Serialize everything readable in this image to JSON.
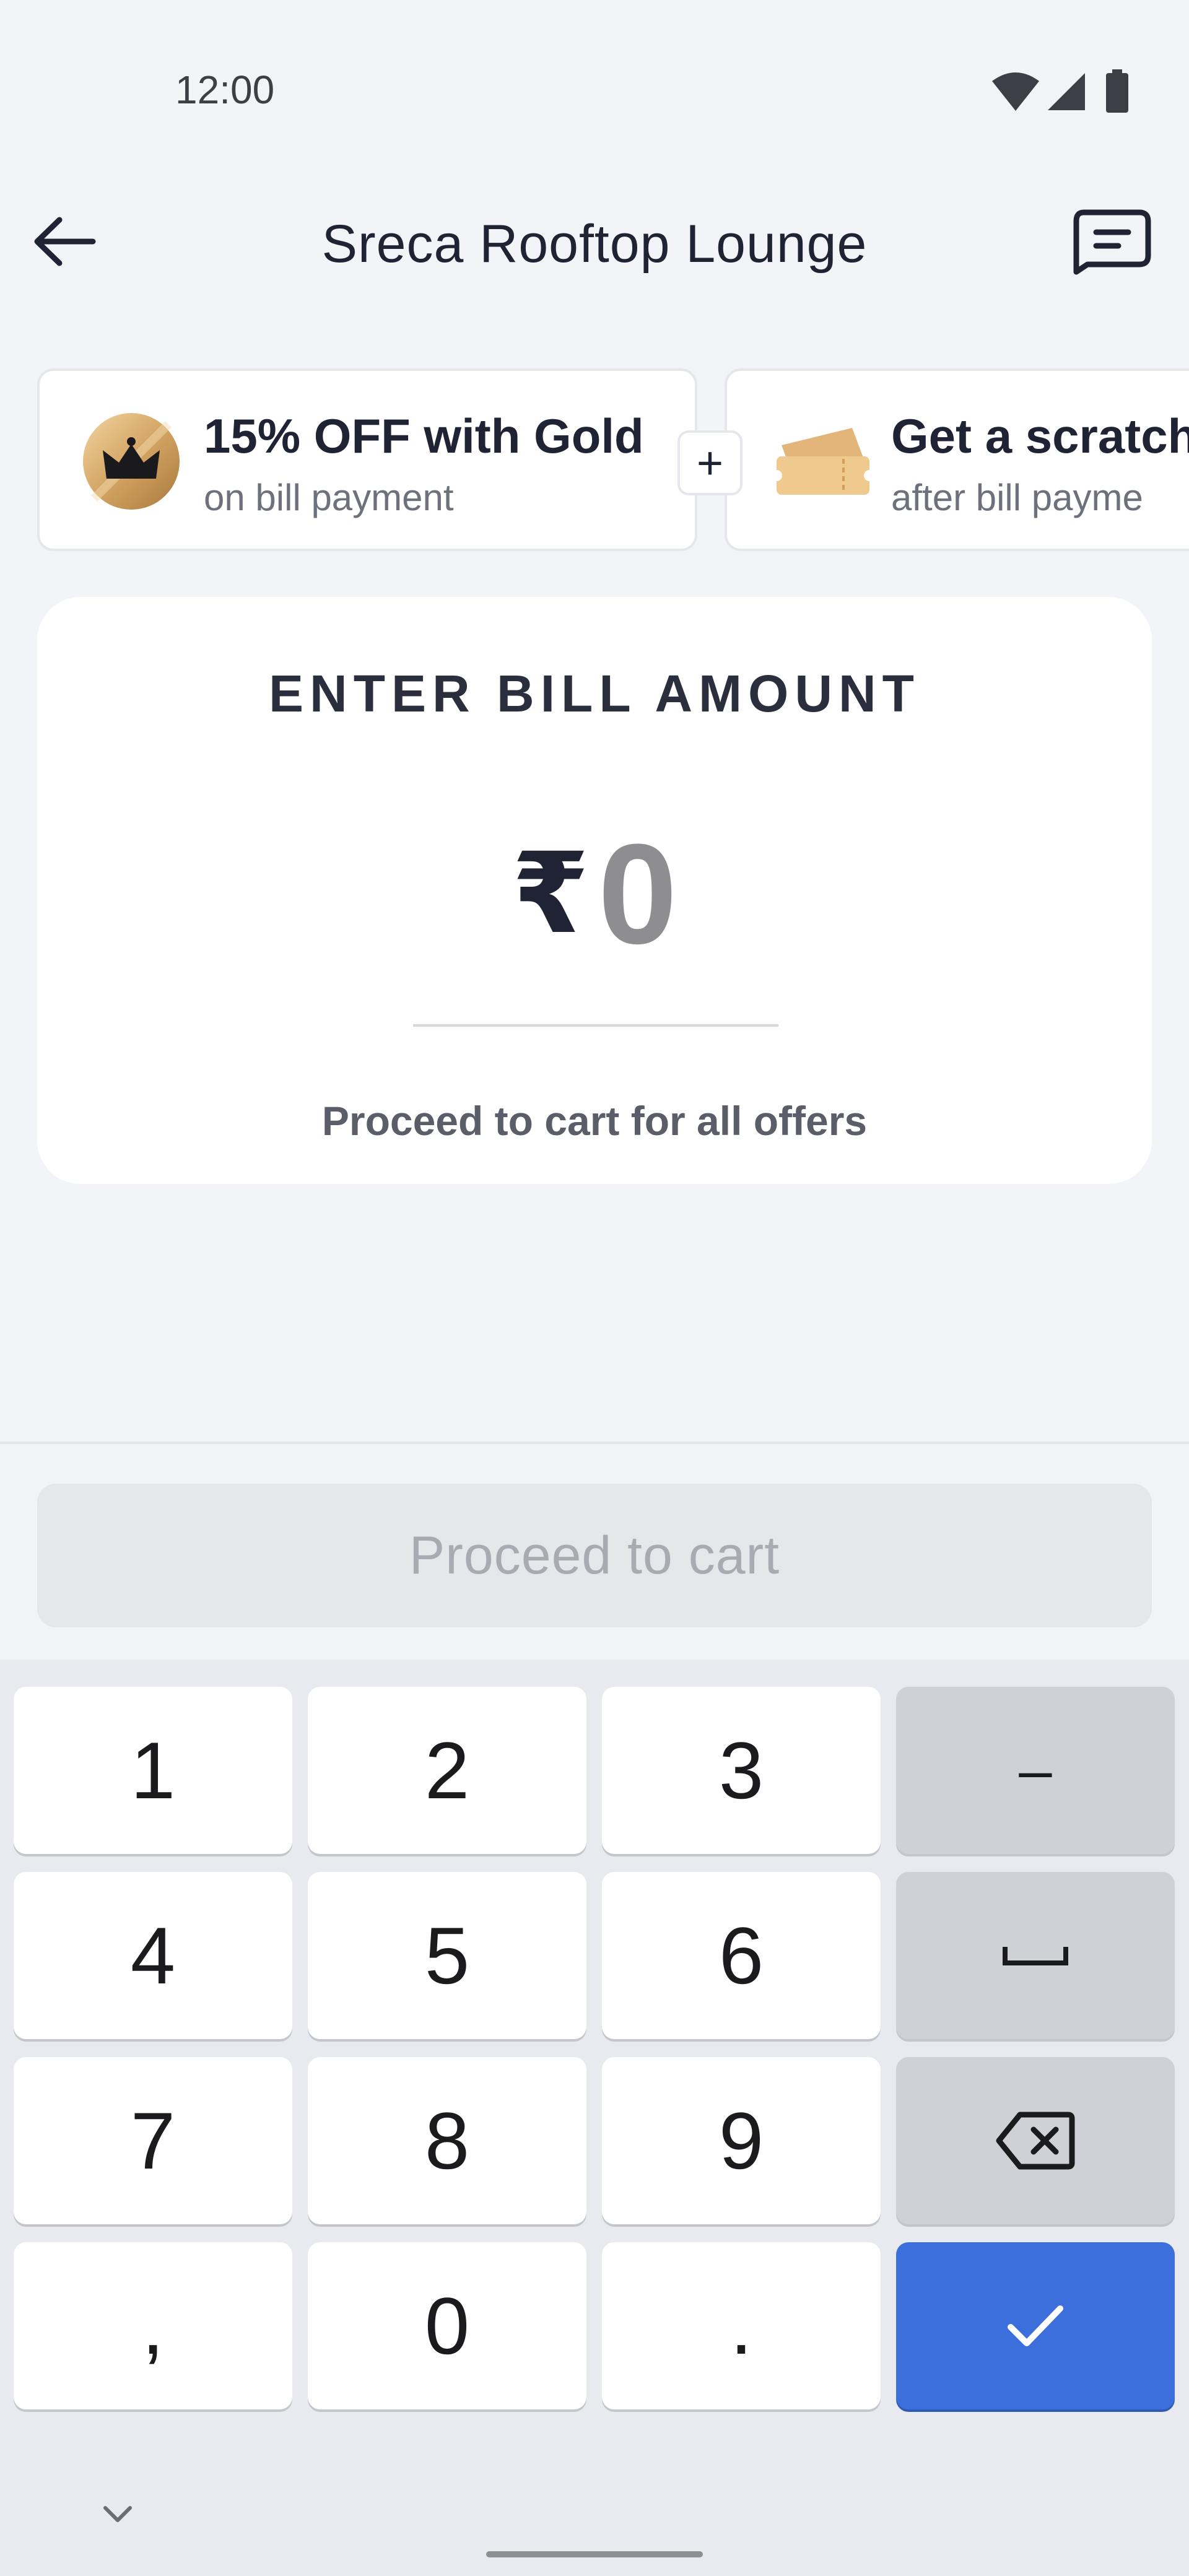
{
  "status_bar": {
    "time": "12:00",
    "icons": [
      "wifi-icon",
      "cellular-icon",
      "battery-icon"
    ]
  },
  "header": {
    "title": "Sreca Rooftop Lounge",
    "back_icon": "arrow-left-icon",
    "chat_icon": "chat-icon"
  },
  "offers": [
    {
      "icon": "gold-crown-icon",
      "title": "15% OFF with Gold",
      "subtitle": "on bill payment"
    },
    {
      "icon": "ticket-icon",
      "title": "Get a scratch",
      "subtitle": "after bill payme"
    }
  ],
  "offer_separator": "+",
  "bill": {
    "heading": "ENTER BILL AMOUNT",
    "currency": "₹",
    "amount": "0",
    "note": "Proceed to cart for all offers"
  },
  "cta": {
    "proceed_label": "Proceed to cart"
  },
  "keyboard": {
    "keys": {
      "k1": "1",
      "k2": "2",
      "k3": "3",
      "dash": "–",
      "k4": "4",
      "k5": "5",
      "k6": "6",
      "k7": "7",
      "k8": "8",
      "k9": "9",
      "comma": ",",
      "k0": "0",
      "period": "."
    },
    "space_icon": "space-icon",
    "backspace_icon": "backspace-icon",
    "done_icon": "check-icon",
    "hide_icon": "chevron-down-icon"
  },
  "colors": {
    "background": "#f3f4f8",
    "accent": "#3d6fdc",
    "gold": "#c99a55",
    "disabled_button": "#e6e7eb"
  }
}
